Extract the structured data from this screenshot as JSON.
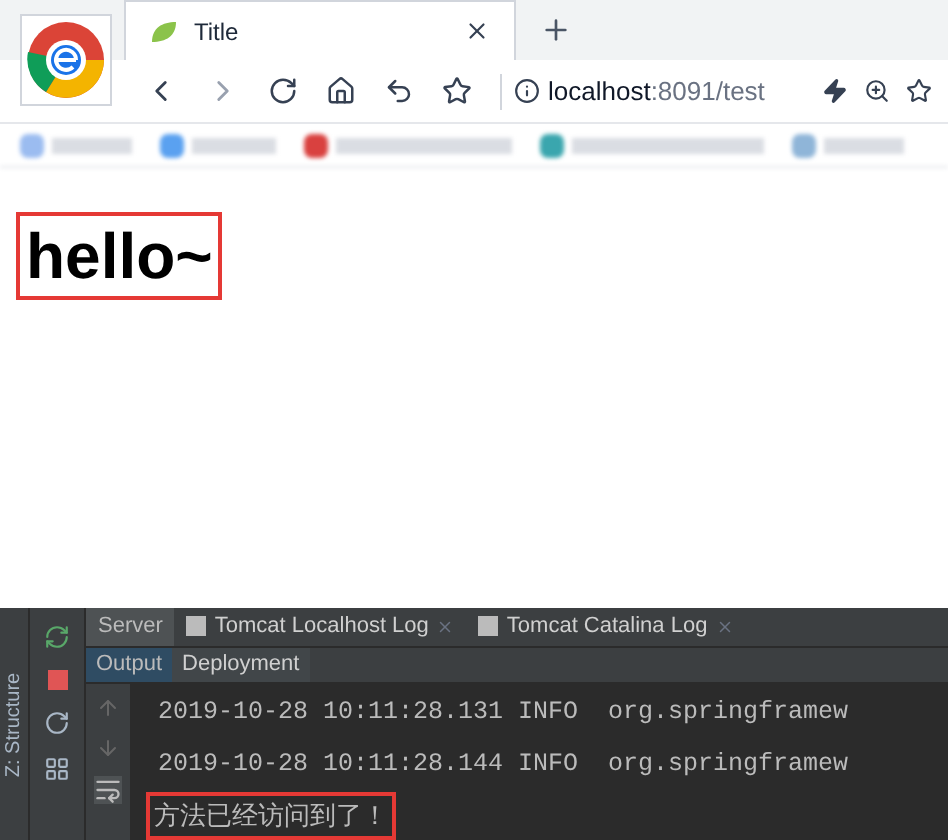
{
  "browser": {
    "tabs": [
      {
        "title": "Title",
        "selected": true
      }
    ],
    "address": {
      "host": "localhost",
      "rest": ":8091/test"
    }
  },
  "page": {
    "heading": "hello~",
    "highlighted": true
  },
  "ide": {
    "side_label": "Z: Structure",
    "tabs": [
      {
        "label": "Server",
        "selected": true,
        "closable": false
      },
      {
        "label": "Tomcat Localhost Log",
        "selected": false,
        "closable": true
      },
      {
        "label": "Tomcat Catalina Log",
        "selected": false,
        "closable": true
      }
    ],
    "subtabs": [
      {
        "label": "Output",
        "selected": true
      },
      {
        "label": "Deployment",
        "selected": false
      }
    ],
    "console": [
      {
        "text": "2019-10-28 10:11:28.131 INFO  org.springframew",
        "highlighted": false
      },
      {
        "text": "2019-10-28 10:11:28.144 INFO  org.springframew",
        "highlighted": false
      },
      {
        "text": "方法已经访问到了！",
        "highlighted": true
      }
    ]
  }
}
